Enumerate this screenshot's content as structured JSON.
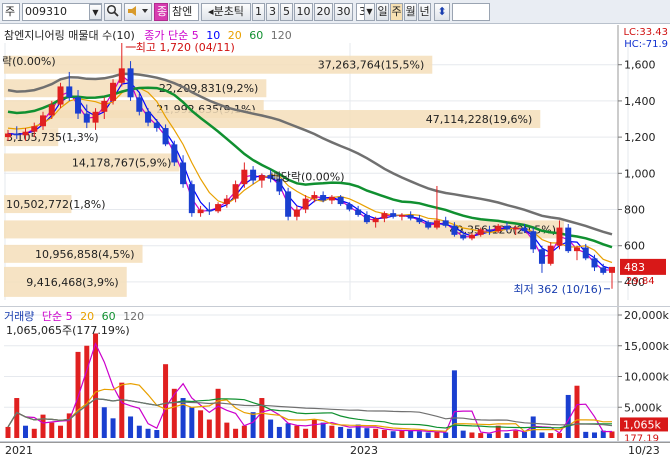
{
  "toolbar": {
    "market_label": "주",
    "code": "009310",
    "mark_label": "종",
    "name": "참엔",
    "mode_label": "◂분초틱",
    "periods": [
      "1",
      "3",
      "5",
      "10",
      "20",
      "30"
    ],
    "count_value": "3",
    "day_label": "일",
    "week_label": "주",
    "month_label": "월",
    "year_label": "년"
  },
  "price_panel": {
    "title": "참엔지니어링 매물대 수(10)",
    "ma_label": "종가 단순",
    "ma_periods": [
      "5",
      "10",
      "20",
      "60",
      "120"
    ],
    "ma_colors": [
      "#cc00cc",
      "#0000ff",
      "#e8a000",
      "#109030",
      "#707070"
    ],
    "lc_label": "LC:33.43",
    "hc_label": "HC:-71.9",
    "axis_ticks": [
      "1,600",
      "1,400",
      "1,200",
      "1,000",
      "800",
      "600",
      "400"
    ],
    "current_price": "483",
    "pct_tag": "29.84",
    "high_annot": "최고 1,720 (04/11)",
    "low_annot": "최저 362 (10/16)",
    "dividend_left": "락(0.00%)",
    "dividend_mid": "배당락(0.00%)",
    "volume_profile": [
      {
        "label": "37,263,764(15,5%)",
        "value": 37263764,
        "pct": 15.5
      },
      {
        "label": "22,209,831(9,2%)",
        "value": 22209831,
        "pct": 9.2
      },
      {
        "label": "21,992,635(9,1%)",
        "value": 21992635,
        "pct": 9.1
      },
      {
        "label": "47,114,228(19,6%)",
        "value": 47114228,
        "pct": 19.6
      },
      {
        "label": "3,105,735(1,3%)",
        "value": 3105735,
        "pct": 1.3
      },
      {
        "label": "14,178,767(5,9%)",
        "value": 14178767,
        "pct": 5.9
      },
      {
        "label": "10,502,772(1,8%)",
        "value": 10502772,
        "pct": 1.8
      },
      {
        "label": "49,356,120(20,5%)",
        "value": 49356120,
        "pct": 20.5
      },
      {
        "label": "10,956,858(4,5%)",
        "value": 10956858,
        "pct": 4.5
      },
      {
        "label": "9,416,468(3,9%)",
        "value": 9416468,
        "pct": 3.9
      }
    ],
    "candles": [
      {
        "o": 1200,
        "h": 1240,
        "l": 1180,
        "c": 1220
      },
      {
        "o": 1220,
        "h": 1260,
        "l": 1190,
        "c": 1210
      },
      {
        "o": 1210,
        "h": 1250,
        "l": 1180,
        "c": 1230
      },
      {
        "o": 1230,
        "h": 1280,
        "l": 1200,
        "c": 1260
      },
      {
        "o": 1260,
        "h": 1340,
        "l": 1240,
        "c": 1320
      },
      {
        "o": 1320,
        "h": 1400,
        "l": 1300,
        "c": 1380
      },
      {
        "o": 1380,
        "h": 1500,
        "l": 1360,
        "c": 1480
      },
      {
        "o": 1480,
        "h": 1560,
        "l": 1400,
        "c": 1420
      },
      {
        "o": 1420,
        "h": 1460,
        "l": 1300,
        "c": 1330
      },
      {
        "o": 1330,
        "h": 1380,
        "l": 1250,
        "c": 1280
      },
      {
        "o": 1280,
        "h": 1360,
        "l": 1240,
        "c": 1340
      },
      {
        "o": 1340,
        "h": 1420,
        "l": 1300,
        "c": 1400
      },
      {
        "o": 1400,
        "h": 1520,
        "l": 1380,
        "c": 1500
      },
      {
        "o": 1500,
        "h": 1720,
        "l": 1480,
        "c": 1580
      },
      {
        "o": 1580,
        "h": 1620,
        "l": 1400,
        "c": 1420
      },
      {
        "o": 1420,
        "h": 1440,
        "l": 1320,
        "c": 1340
      },
      {
        "o": 1340,
        "h": 1360,
        "l": 1260,
        "c": 1280
      },
      {
        "o": 1280,
        "h": 1300,
        "l": 1230,
        "c": 1250
      },
      {
        "o": 1250,
        "h": 1270,
        "l": 1150,
        "c": 1160
      },
      {
        "o": 1160,
        "h": 1180,
        "l": 1040,
        "c": 1060
      },
      {
        "o": 1060,
        "h": 1100,
        "l": 920,
        "c": 940
      },
      {
        "o": 940,
        "h": 960,
        "l": 760,
        "c": 780
      },
      {
        "o": 780,
        "h": 820,
        "l": 760,
        "c": 800
      },
      {
        "o": 800,
        "h": 840,
        "l": 770,
        "c": 790
      },
      {
        "o": 790,
        "h": 840,
        "l": 780,
        "c": 830
      },
      {
        "o": 830,
        "h": 880,
        "l": 810,
        "c": 860
      },
      {
        "o": 860,
        "h": 960,
        "l": 840,
        "c": 940
      },
      {
        "o": 940,
        "h": 1060,
        "l": 920,
        "c": 1020
      },
      {
        "o": 1020,
        "h": 1040,
        "l": 940,
        "c": 960
      },
      {
        "o": 960,
        "h": 1000,
        "l": 920,
        "c": 990
      },
      {
        "o": 990,
        "h": 1020,
        "l": 950,
        "c": 970
      },
      {
        "o": 970,
        "h": 1000,
        "l": 880,
        "c": 900
      },
      {
        "o": 900,
        "h": 920,
        "l": 740,
        "c": 760
      },
      {
        "o": 760,
        "h": 820,
        "l": 740,
        "c": 800
      },
      {
        "o": 800,
        "h": 880,
        "l": 780,
        "c": 860
      },
      {
        "o": 860,
        "h": 900,
        "l": 840,
        "c": 880
      },
      {
        "o": 880,
        "h": 900,
        "l": 840,
        "c": 850
      },
      {
        "o": 850,
        "h": 880,
        "l": 830,
        "c": 870
      },
      {
        "o": 870,
        "h": 880,
        "l": 820,
        "c": 830
      },
      {
        "o": 830,
        "h": 840,
        "l": 790,
        "c": 800
      },
      {
        "o": 800,
        "h": 820,
        "l": 760,
        "c": 770
      },
      {
        "o": 770,
        "h": 790,
        "l": 720,
        "c": 730
      },
      {
        "o": 730,
        "h": 760,
        "l": 700,
        "c": 750
      },
      {
        "o": 750,
        "h": 790,
        "l": 730,
        "c": 780
      },
      {
        "o": 780,
        "h": 800,
        "l": 750,
        "c": 760
      },
      {
        "o": 760,
        "h": 780,
        "l": 740,
        "c": 770
      },
      {
        "o": 770,
        "h": 790,
        "l": 740,
        "c": 750
      },
      {
        "o": 750,
        "h": 770,
        "l": 720,
        "c": 730
      },
      {
        "o": 730,
        "h": 740,
        "l": 690,
        "c": 700
      },
      {
        "o": 700,
        "h": 930,
        "l": 690,
        "c": 740
      },
      {
        "o": 740,
        "h": 760,
        "l": 700,
        "c": 710
      },
      {
        "o": 710,
        "h": 730,
        "l": 650,
        "c": 660
      },
      {
        "o": 660,
        "h": 680,
        "l": 630,
        "c": 640
      },
      {
        "o": 640,
        "h": 670,
        "l": 630,
        "c": 660
      },
      {
        "o": 660,
        "h": 700,
        "l": 650,
        "c": 690
      },
      {
        "o": 690,
        "h": 710,
        "l": 660,
        "c": 680
      },
      {
        "o": 680,
        "h": 720,
        "l": 670,
        "c": 710
      },
      {
        "o": 710,
        "h": 730,
        "l": 680,
        "c": 690
      },
      {
        "o": 690,
        "h": 710,
        "l": 660,
        "c": 700
      },
      {
        "o": 700,
        "h": 720,
        "l": 670,
        "c": 680
      },
      {
        "o": 680,
        "h": 700,
        "l": 560,
        "c": 580
      },
      {
        "o": 580,
        "h": 600,
        "l": 450,
        "c": 500
      },
      {
        "o": 500,
        "h": 620,
        "l": 490,
        "c": 600
      },
      {
        "o": 600,
        "h": 740,
        "l": 580,
        "c": 700
      },
      {
        "o": 700,
        "h": 720,
        "l": 560,
        "c": 570
      },
      {
        "o": 570,
        "h": 600,
        "l": 520,
        "c": 590
      },
      {
        "o": 590,
        "h": 610,
        "l": 520,
        "c": 530
      },
      {
        "o": 530,
        "h": 550,
        "l": 460,
        "c": 480
      },
      {
        "o": 480,
        "h": 500,
        "l": 440,
        "c": 450
      },
      {
        "o": 450,
        "h": 470,
        "l": 362,
        "c": 483
      }
    ]
  },
  "volume_panel": {
    "title": "거래량",
    "ma_label": "단순",
    "ma_periods": [
      "5",
      "20",
      "60",
      "120"
    ],
    "first_value": "1,065,065주(177.19%)",
    "axis_ticks": [
      "20,000k",
      "15,000k",
      "10,000k",
      "5,000k"
    ],
    "current_value": "1,065k",
    "pct_tag": "177.19",
    "volumes": [
      1800,
      6500,
      2000,
      1500,
      3800,
      2500,
      2000,
      4000,
      14000,
      15000,
      17000,
      5000,
      3200,
      9000,
      3500,
      2000,
      1500,
      1300,
      12000,
      8000,
      6500,
      5000,
      4500,
      3000,
      8000,
      2500,
      1500,
      2000,
      4200,
      6500,
      3000,
      1800,
      2400,
      2000,
      1500,
      3000,
      2500,
      2000,
      1800,
      1500,
      2200,
      1600,
      1500,
      1300,
      1100,
      1300,
      1200,
      1100,
      900,
      1000,
      900,
      11000,
      1200,
      900,
      800,
      700,
      2000,
      800,
      1200,
      1000,
      3500,
      900,
      800,
      800,
      7000,
      8500,
      1000,
      900,
      1200,
      1065
    ],
    "up_flags": [
      1,
      1,
      0,
      1,
      1,
      1,
      1,
      1,
      1,
      1,
      1,
      0,
      0,
      1,
      0,
      0,
      0,
      0,
      1,
      1,
      0,
      0,
      1,
      1,
      1,
      1,
      1,
      1,
      0,
      1,
      0,
      0,
      0,
      1,
      1,
      1,
      0,
      1,
      0,
      0,
      0,
      0,
      1,
      1,
      0,
      1,
      0,
      0,
      0,
      1,
      0,
      0,
      0,
      1,
      1,
      0,
      1,
      0,
      1,
      0,
      0,
      0,
      1,
      1,
      0,
      1,
      0,
      0,
      0,
      1
    ]
  },
  "x_axis": {
    "labels": [
      "2021",
      "2023",
      "10/23"
    ]
  }
}
